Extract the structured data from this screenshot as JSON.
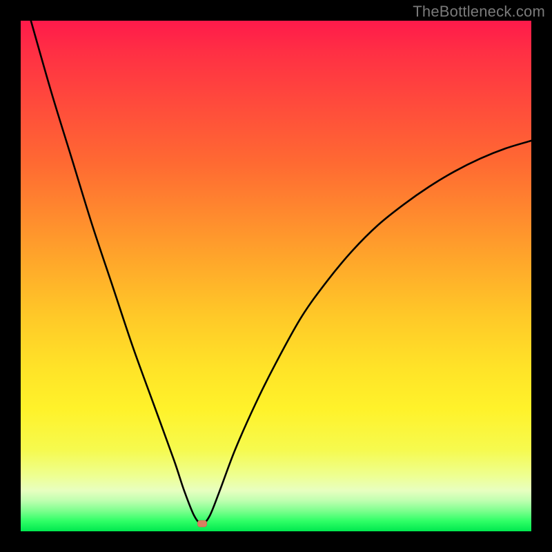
{
  "watermark": "TheBottleneck.com",
  "colors": {
    "curve": "#000000",
    "marker": "#d97f60",
    "background_top": "#ff1a4b",
    "background_bottom": "#00e84f",
    "frame": "#000000"
  },
  "chart_data": {
    "type": "line",
    "title": "",
    "xlabel": "",
    "ylabel": "",
    "xlim": [
      0,
      100
    ],
    "ylim": [
      0,
      100
    ],
    "grid": false,
    "legend": false,
    "marker": {
      "x": 35.5,
      "y": 1.5
    },
    "series": [
      {
        "name": "bottleneck-curve",
        "x": [
          2,
          6,
          10,
          14,
          18,
          22,
          26,
          30,
          32,
          34,
          35.5,
          37,
          39,
          42,
          46,
          50,
          55,
          60,
          65,
          70,
          75,
          80,
          85,
          90,
          95,
          100
        ],
        "y": [
          100,
          86,
          73,
          60,
          48,
          36,
          25,
          14,
          8,
          3,
          1.5,
          3,
          8,
          16,
          25,
          33,
          42,
          49,
          55,
          60,
          64,
          67.5,
          70.5,
          73,
          75,
          76.5
        ]
      }
    ]
  }
}
